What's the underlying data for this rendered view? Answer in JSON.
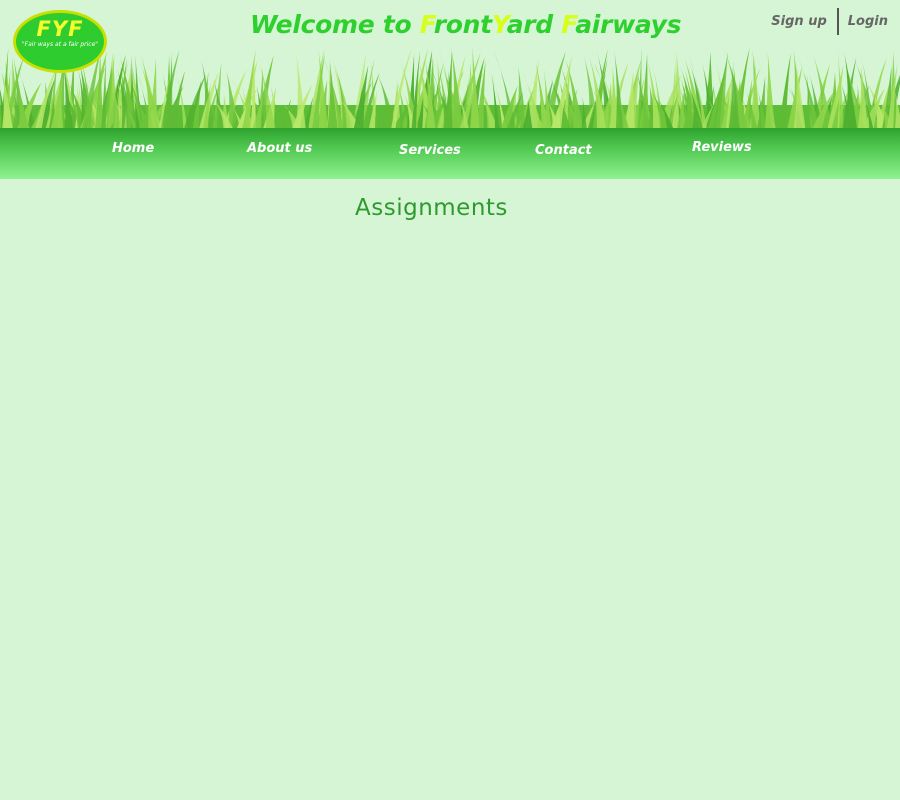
{
  "header": {
    "logo": {
      "text": "FYF",
      "slogan": "\"Fair ways at a fair price\""
    },
    "welcome": {
      "prefix": "Welcome to ",
      "parts": [
        {
          "first": "F",
          "rest": "ront"
        },
        {
          "first": "Y",
          "rest": "ard "
        },
        {
          "first": "F",
          "rest": "airways"
        }
      ]
    },
    "auth": {
      "signup_label": "Sign up",
      "login_label": "Login"
    }
  },
  "nav": {
    "items": [
      {
        "label": "Home"
      },
      {
        "label": "About us"
      },
      {
        "label": "Services"
      },
      {
        "label": "Contact"
      },
      {
        "label": "Reviews"
      }
    ]
  },
  "main": {
    "title": "Assignments"
  },
  "colors": {
    "background": "#d5f5d5",
    "brand_green": "#2ed02e",
    "highlight_yellow": "#d8ff1a",
    "title_green": "#2e9a2e"
  }
}
